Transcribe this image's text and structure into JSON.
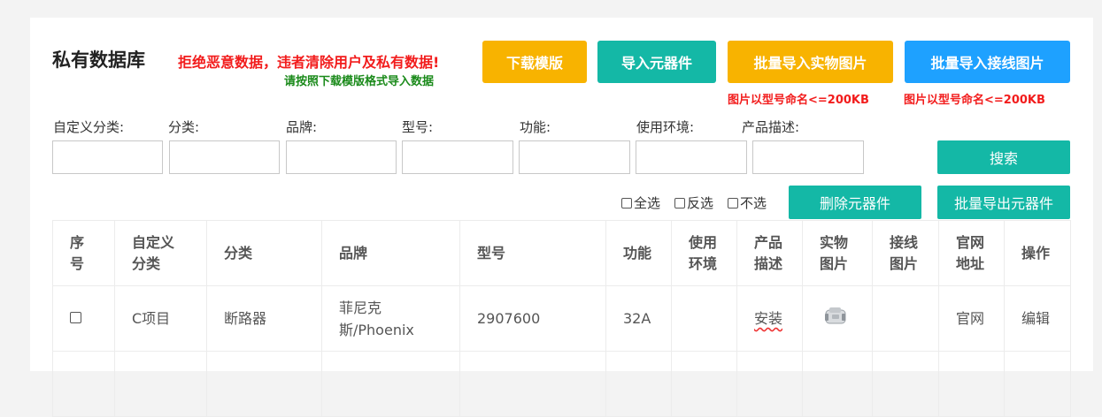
{
  "header": {
    "title": "私有数据库",
    "warning": "拒绝恶意数据，违者清除用户及私有数据!",
    "hint": "请按照下载模版格式导入数据"
  },
  "actions": {
    "download_template": "下载模版",
    "import_components": "导入元器件",
    "batch_import_photos": "批量导入实物图片",
    "batch_import_wiring": "批量导入接线图片",
    "photos_note": "图片以型号命名<=200KB",
    "wiring_note": "图片以型号命名<=200KB"
  },
  "filters": {
    "custom_category": {
      "label": "自定义分类:",
      "value": ""
    },
    "category": {
      "label": "分类:",
      "value": ""
    },
    "brand": {
      "label": "品牌:",
      "value": ""
    },
    "model": {
      "label": "型号:",
      "value": ""
    },
    "function": {
      "label": "功能:",
      "value": ""
    },
    "environment": {
      "label": "使用环境:",
      "value": ""
    },
    "description": {
      "label": "产品描述:",
      "value": ""
    },
    "search_label": "搜索"
  },
  "selection": {
    "select_all": "全选",
    "invert": "反选",
    "none": "不选",
    "delete_label": "删除元器件",
    "export_label": "批量导出元器件"
  },
  "table": {
    "headers": [
      "序号",
      "自定义分类",
      "分类",
      "品牌",
      "型号",
      "功能",
      "使用环境",
      "产品描述",
      "实物图片",
      "接线图片",
      "官网地址",
      "操作"
    ],
    "header_lines": [
      [
        "序",
        "号"
      ],
      [
        "自定义",
        "分类"
      ],
      [
        "分类"
      ],
      [
        "品牌"
      ],
      [
        "型号"
      ],
      [
        "功能"
      ],
      [
        "使用",
        "环境"
      ],
      [
        "产品",
        "描述"
      ],
      [
        "实物",
        "图片"
      ],
      [
        "接线",
        "图片"
      ],
      [
        "官网",
        "地址"
      ],
      [
        "操作"
      ]
    ],
    "rows": [
      {
        "custom_category": "C项目",
        "category": "断路器",
        "brand": "菲尼克斯/Phoenix",
        "brand_lines": [
          "菲尼克",
          "斯/Phoenix"
        ],
        "model": "2907600",
        "function": "32A",
        "environment": "",
        "description": "安装",
        "photo_icon": "product-thumbnail",
        "wiring": "",
        "website": "官网",
        "operation": "编辑"
      }
    ]
  }
}
